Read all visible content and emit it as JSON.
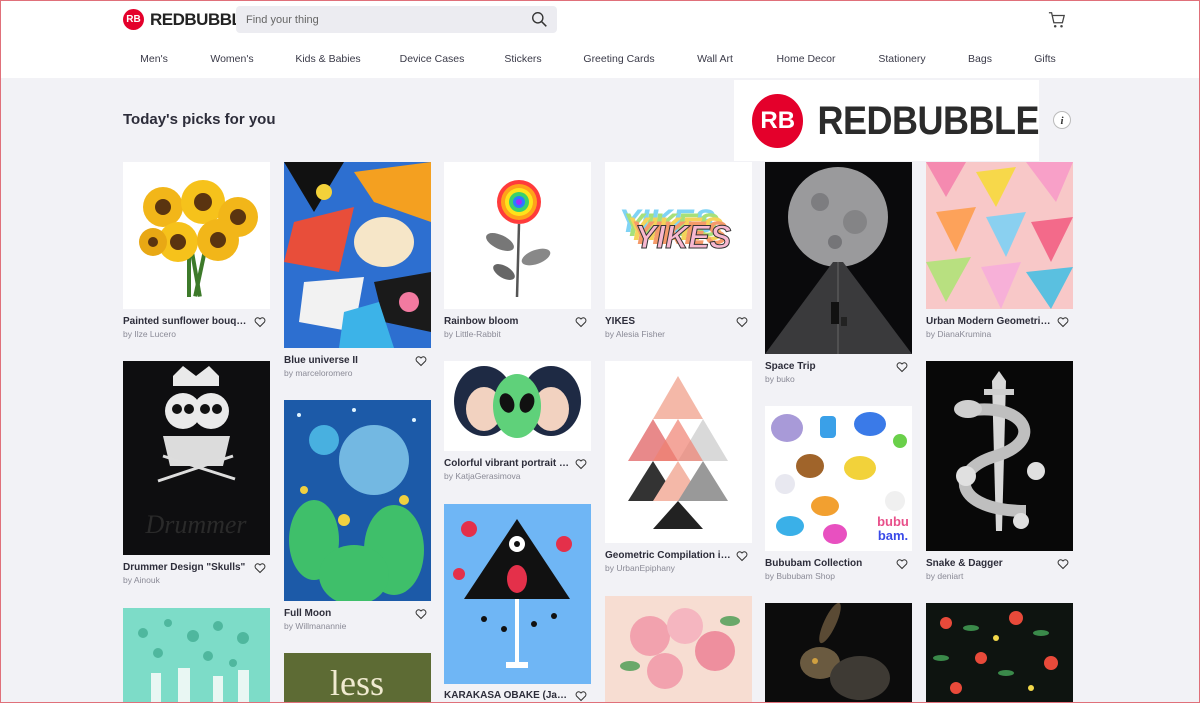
{
  "header": {
    "logo_badge": "RB",
    "logo_text": "REDBUBBLE",
    "search_placeholder": "Find your thing"
  },
  "nav": [
    "Men's",
    "Women's",
    "Kids & Babies",
    "Device Cases",
    "Stickers",
    "Greeting Cards",
    "Wall Art",
    "Home Decor",
    "Stationery",
    "Bags",
    "Gifts"
  ],
  "section_title": "Today's picks for you",
  "promo": {
    "badge": "RB",
    "text": "REDBUBBLE"
  },
  "info_label": "i",
  "cards": [
    {
      "title": "Painted sunflower bouquet",
      "artist": "by Ilze Lucero"
    },
    {
      "title": "Drummer Design \"Skulls\"",
      "artist": "by Ainouk"
    },
    {
      "title": "",
      "artist": ""
    },
    {
      "title": "Blue universe II",
      "artist": "by marceloromero"
    },
    {
      "title": "Full Moon",
      "artist": "by Willmanannie"
    },
    {
      "title": "",
      "artist": ""
    },
    {
      "title": "Rainbow bloom",
      "artist": "by Little-Rabbit"
    },
    {
      "title": "Colorful vibrant portrait of alien",
      "artist": "by KatjaGerasimova"
    },
    {
      "title": "KARAKASA OBAKE (Japanese umbrella)",
      "artist": ""
    },
    {
      "title": "YIKES",
      "artist": "by Alesia Fisher"
    },
    {
      "title": "Geometric Compilation in Rose",
      "artist": "by UrbanEpiphany"
    },
    {
      "title": "",
      "artist": ""
    },
    {
      "title": "Space Trip",
      "artist": "by buko"
    },
    {
      "title": "Bububam Collection",
      "artist": "by Bububam Shop"
    },
    {
      "title": "",
      "artist": ""
    },
    {
      "title": "Urban Modern Geometric Triangles",
      "artist": "by DianaKrumina"
    },
    {
      "title": "Snake & Dagger",
      "artist": "by deniart"
    },
    {
      "title": "",
      "artist": ""
    }
  ],
  "colors": {
    "brand": "#e4002b",
    "page_bg": "#f2f2f6"
  }
}
